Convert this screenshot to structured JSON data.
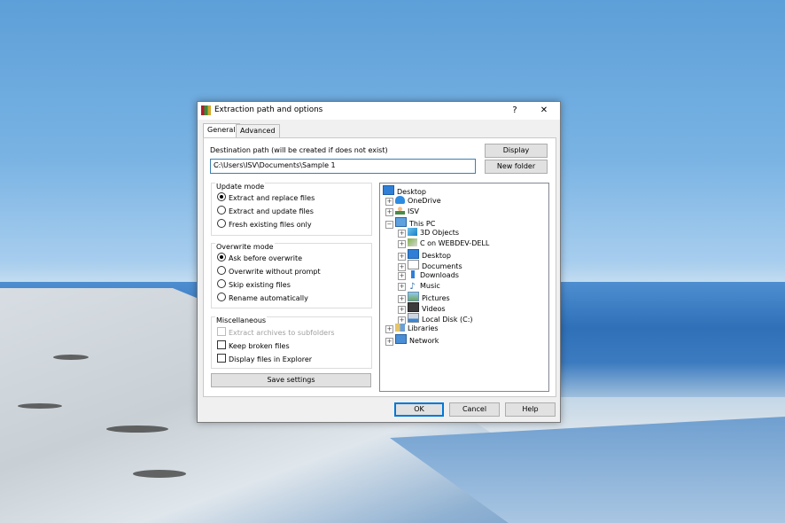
{
  "window": {
    "title": "Extraction path and options",
    "help_glyph": "?",
    "close_glyph": "✕"
  },
  "tabs": [
    "General",
    "Advanced"
  ],
  "destination": {
    "label": "Destination path (will be created if does not exist)",
    "value": "C:\\Users\\ISV\\Documents\\Sample 1"
  },
  "buttons": {
    "display": "Display",
    "new_folder": "New folder",
    "save_settings": "Save settings",
    "ok": "OK",
    "cancel": "Cancel",
    "help": "Help"
  },
  "update_mode": {
    "title": "Update mode",
    "options": [
      "Extract and replace files",
      "Extract and update files",
      "Fresh existing files only"
    ],
    "selected": 0
  },
  "overwrite_mode": {
    "title": "Overwrite mode",
    "options": [
      "Ask before overwrite",
      "Overwrite without prompt",
      "Skip existing files",
      "Rename automatically"
    ],
    "selected": 0
  },
  "misc": {
    "title": "Miscellaneous",
    "options": [
      {
        "label": "Extract archives to subfolders",
        "checked": false,
        "disabled": true
      },
      {
        "label": "Keep broken files",
        "checked": false,
        "disabled": false
      },
      {
        "label": "Display files in Explorer",
        "checked": false,
        "disabled": false
      }
    ]
  },
  "tree": [
    {
      "label": "Desktop",
      "icon": "desktop-icon"
    },
    {
      "label": "OneDrive",
      "icon": "onedrive-icon"
    },
    {
      "label": "ISV",
      "icon": "user-folder-icon"
    },
    {
      "label": "This PC",
      "icon": "this-pc-icon"
    },
    {
      "label": "3D Objects",
      "icon": "3d-objects-icon"
    },
    {
      "label": "C on WEBDEV-DELL",
      "icon": "network-drive-icon"
    },
    {
      "label": "Desktop",
      "icon": "desktop-icon"
    },
    {
      "label": "Documents",
      "icon": "documents-icon"
    },
    {
      "label": "Downloads",
      "icon": "downloads-icon"
    },
    {
      "label": "Music",
      "icon": "music-icon"
    },
    {
      "label": "Pictures",
      "icon": "pictures-icon"
    },
    {
      "label": "Videos",
      "icon": "videos-icon"
    },
    {
      "label": "Local Disk (C:)",
      "icon": "local-disk-icon"
    },
    {
      "label": "Libraries",
      "icon": "libraries-icon"
    },
    {
      "label": "Network",
      "icon": "network-icon"
    }
  ]
}
